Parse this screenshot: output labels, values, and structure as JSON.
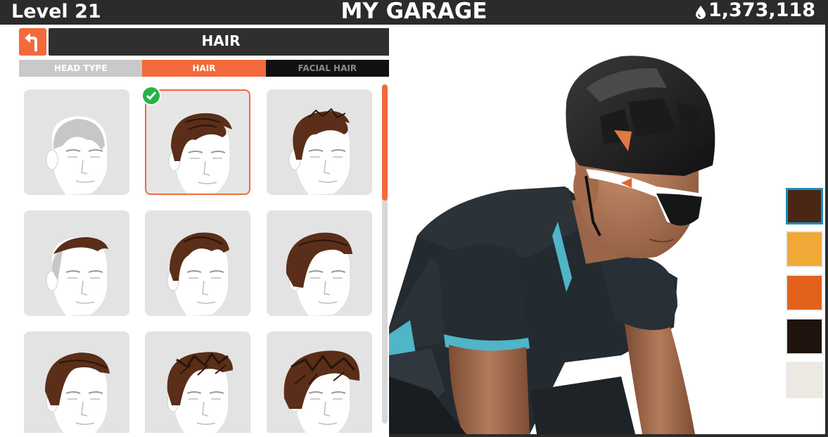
{
  "header": {
    "level_label": "Level 21",
    "title": "MY GARAGE",
    "drops_value": "1,373,118"
  },
  "panel": {
    "section_title": "HAIR",
    "tabs": [
      {
        "label": "HEAD TYPE",
        "active": false
      },
      {
        "label": "HAIR",
        "active": true
      },
      {
        "label": "FACIAL HAIR",
        "active": false
      }
    ]
  },
  "hair_options": [
    {
      "name": "bald",
      "selected": false
    },
    {
      "name": "short-swept",
      "selected": true
    },
    {
      "name": "short-spiky",
      "selected": false
    },
    {
      "name": "undercut",
      "selected": false
    },
    {
      "name": "pompadour",
      "selected": false
    },
    {
      "name": "side-swept",
      "selected": false
    },
    {
      "name": "side-part",
      "selected": false
    },
    {
      "name": "messy",
      "selected": false
    },
    {
      "name": "shaggy",
      "selected": false
    }
  ],
  "hair_colors": [
    {
      "hex": "#4a2614",
      "selected": true
    },
    {
      "hex": "#f0a836",
      "selected": false
    },
    {
      "hex": "#e2621c",
      "selected": false
    },
    {
      "hex": "#20130e",
      "selected": false
    },
    {
      "hex": "#ece9e3",
      "selected": false
    }
  ],
  "colors": {
    "accent": "#f26a3b",
    "topbar": "#2b2b2b",
    "check": "#27b24a"
  }
}
